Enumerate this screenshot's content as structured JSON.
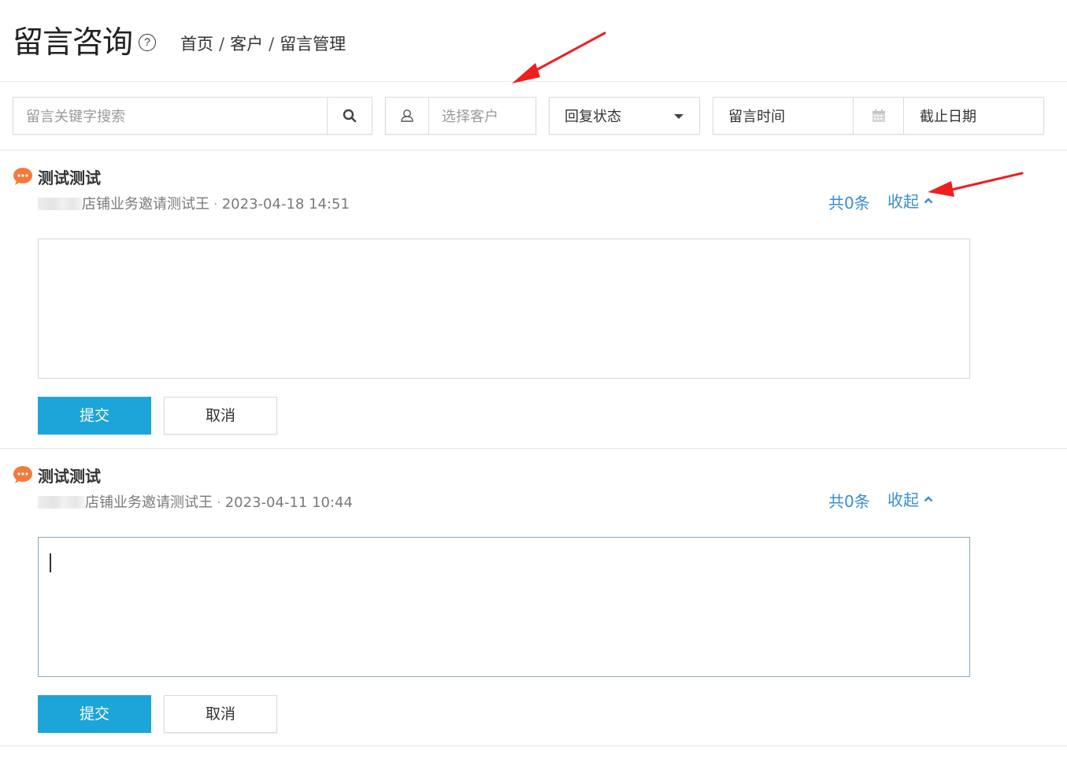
{
  "header": {
    "title": "留言咨询",
    "help_icon": "?",
    "breadcrumb": [
      "首页",
      "客户",
      "留言管理"
    ],
    "separator": "/"
  },
  "filters": {
    "search_placeholder": "留言关键字搜索",
    "customer_placeholder": "选择客户",
    "reply_status": "回复状态",
    "start_date": "留言时间",
    "end_date": "截止日期"
  },
  "messages": [
    {
      "title": "测试测试",
      "author": "店铺业务邀请测试王",
      "time": "2023-04-18 14:51",
      "count": "共0条",
      "collapse": "收起",
      "submit": "提交",
      "cancel": "取消"
    },
    {
      "title": "测试测试",
      "author": "店铺业务邀请测试王",
      "time": "2023-04-11 10:44",
      "count": "共0条",
      "collapse": "收起",
      "submit": "提交",
      "cancel": "取消"
    }
  ],
  "colors": {
    "primary": "#1ba5d9",
    "link": "#3a8ed2",
    "bubble": "#f47a3c",
    "annotation_arrow": "#f01e1e"
  }
}
